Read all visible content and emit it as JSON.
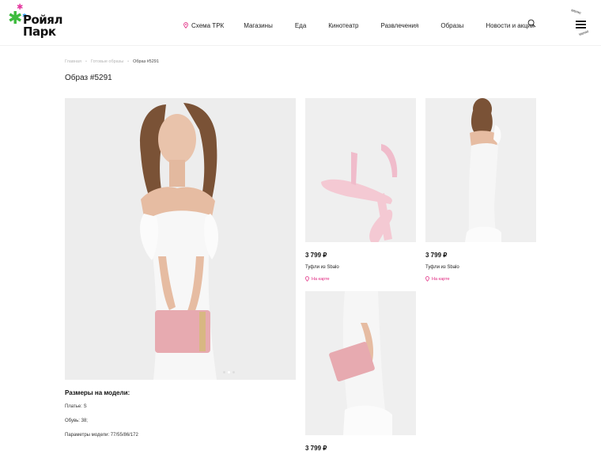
{
  "header": {
    "logo": {
      "line1": "Ройял",
      "line2": "Парк"
    },
    "nav": [
      {
        "label": "Схема ТРК",
        "icon": "map-pin-icon"
      },
      {
        "label": "Магазины"
      },
      {
        "label": "Еда"
      },
      {
        "label": "Кинотеатр"
      },
      {
        "label": "Развлечения"
      },
      {
        "label": "Образы"
      },
      {
        "label": "Новости и акции"
      }
    ],
    "menu": {
      "top": "меню",
      "bottom": "меню"
    },
    "accent": "#e0267f"
  },
  "breadcrumb": [
    {
      "label": "Главная"
    },
    {
      "label": "Готовые образы"
    },
    {
      "label": "Образ #5291"
    }
  ],
  "page_title": "Образ #5291",
  "products": [
    {
      "price": "3 799 ₽",
      "name": "Туфли из Sbalo",
      "link": "На карте"
    },
    {
      "price": "3 799 ₽",
      "name": "Туфли из Sbalo",
      "link": "На карте"
    },
    {
      "price": "3 799 ₽"
    }
  ],
  "sizes": {
    "title": "Размеры на модели:",
    "rows": [
      {
        "label": "Платье: S"
      },
      {
        "label": "Обувь: 38;"
      },
      {
        "label": "Параметры модели: 77/55/86/172"
      }
    ]
  }
}
